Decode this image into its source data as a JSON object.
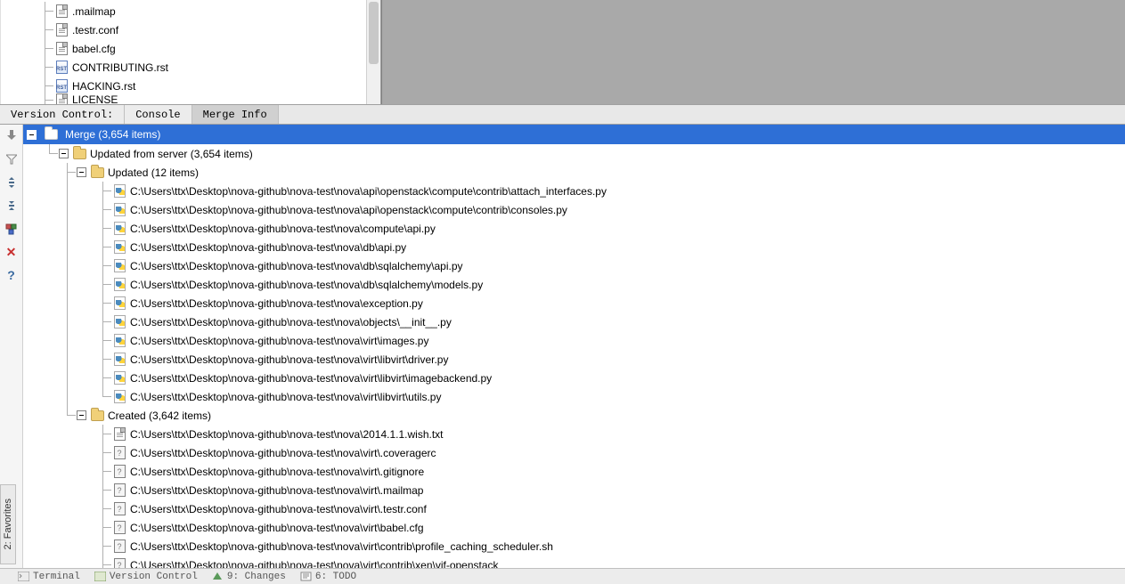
{
  "project_tree": {
    "items": [
      {
        "icon": "txt",
        "label": ".mailmap",
        "level": 3
      },
      {
        "icon": "txt",
        "label": ".testr.conf",
        "level": 3
      },
      {
        "icon": "txt",
        "label": "babel.cfg",
        "level": 3
      },
      {
        "icon": "rst",
        "label": "CONTRIBUTING.rst",
        "level": 3
      },
      {
        "icon": "rst",
        "label": "HACKING.rst",
        "level": 3
      },
      {
        "icon": "txt",
        "label": "LICENSE",
        "level": 3,
        "cut": true
      }
    ]
  },
  "tool_tabs": {
    "version_control": "Version Control:",
    "console": "Console",
    "merge_info": "Merge Info"
  },
  "merge": {
    "root": "Merge (3,654 items)",
    "updated_from_server": "Updated from server (3,654 items)",
    "updated": "Updated (12 items)",
    "updated_files": [
      "C:\\Users\\ttx\\Desktop\\nova-github\\nova-test\\nova\\api\\openstack\\compute\\contrib\\attach_interfaces.py",
      "C:\\Users\\ttx\\Desktop\\nova-github\\nova-test\\nova\\api\\openstack\\compute\\contrib\\consoles.py",
      "C:\\Users\\ttx\\Desktop\\nova-github\\nova-test\\nova\\compute\\api.py",
      "C:\\Users\\ttx\\Desktop\\nova-github\\nova-test\\nova\\db\\api.py",
      "C:\\Users\\ttx\\Desktop\\nova-github\\nova-test\\nova\\db\\sqlalchemy\\api.py",
      "C:\\Users\\ttx\\Desktop\\nova-github\\nova-test\\nova\\db\\sqlalchemy\\models.py",
      "C:\\Users\\ttx\\Desktop\\nova-github\\nova-test\\nova\\exception.py",
      "C:\\Users\\ttx\\Desktop\\nova-github\\nova-test\\nova\\objects\\__init__.py",
      "C:\\Users\\ttx\\Desktop\\nova-github\\nova-test\\nova\\virt\\images.py",
      "C:\\Users\\ttx\\Desktop\\nova-github\\nova-test\\nova\\virt\\libvirt\\driver.py",
      "C:\\Users\\ttx\\Desktop\\nova-github\\nova-test\\nova\\virt\\libvirt\\imagebackend.py",
      "C:\\Users\\ttx\\Desktop\\nova-github\\nova-test\\nova\\virt\\libvirt\\utils.py"
    ],
    "created": "Created (3,642 items)",
    "created_files": [
      "C:\\Users\\ttx\\Desktop\\nova-github\\nova-test\\nova\\2014.1.1.wish.txt",
      "C:\\Users\\ttx\\Desktop\\nova-github\\nova-test\\nova\\virt\\.coveragerc",
      "C:\\Users\\ttx\\Desktop\\nova-github\\nova-test\\nova\\virt\\.gitignore",
      "C:\\Users\\ttx\\Desktop\\nova-github\\nova-test\\nova\\virt\\.mailmap",
      "C:\\Users\\ttx\\Desktop\\nova-github\\nova-test\\nova\\virt\\.testr.conf",
      "C:\\Users\\ttx\\Desktop\\nova-github\\nova-test\\nova\\virt\\babel.cfg",
      "C:\\Users\\ttx\\Desktop\\nova-github\\nova-test\\nova\\virt\\contrib\\profile_caching_scheduler.sh",
      "C:\\Users\\ttx\\Desktop\\nova-github\\nova-test\\nova\\virt\\contrib\\xen\\vif-openstack"
    ]
  },
  "vertical_tab": "2: Favorites",
  "status": {
    "terminal": "Terminal",
    "version_control": "Version Control",
    "changes": "9: Changes",
    "todo": "6: TODO"
  },
  "colors": {
    "selection_bg": "#2e6fd6",
    "selection_fg": "#ffffff",
    "panel_bg": "#f0f0f0",
    "gray_area": "#a9a9a9"
  }
}
